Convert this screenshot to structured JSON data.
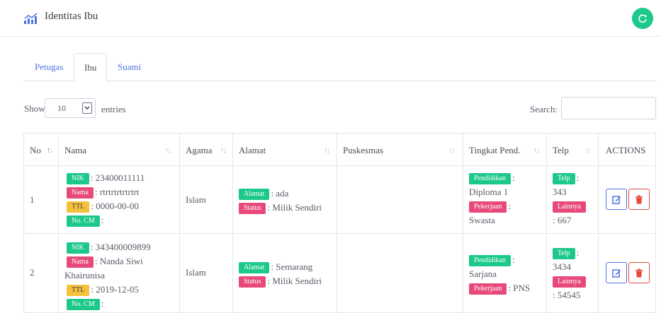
{
  "header": {
    "title": "Identitas Ibu",
    "accent": "#1cc88a"
  },
  "tabs": [
    {
      "label": "Petugas",
      "active": false
    },
    {
      "label": "Ibu",
      "active": true
    },
    {
      "label": "Suami",
      "active": false
    }
  ],
  "controls": {
    "show_label": "Show",
    "entries_value": "10",
    "entries_label": "entries",
    "search_label": "Search:",
    "search_value": ""
  },
  "columns": [
    "No",
    "Nama",
    "Agama",
    "Alamat",
    "Puskesmas",
    "Tingkat Pend.",
    "Telp",
    "ACTIONS"
  ],
  "rows": [
    {
      "no": "1",
      "nik_badge": "NIK",
      "nik": ": 23400011111",
      "nama_badge": "Nama",
      "nama": ": rtrtrtrtrtrtrt",
      "ttl_badge": "TTL",
      "ttl": ": 0000-00-00",
      "nocm_badge": "No. CM",
      "nocm": ":",
      "agama": "Islam",
      "alamat_badge": "Alamat",
      "alamat": ": ada",
      "status_badge": "Status",
      "status": ": Milik Sendiri",
      "puskesmas": "",
      "pendidikan_badge": "Pendidikan",
      "pendidikan_sep": ":",
      "pendidikan": "Diploma 1",
      "pekerjaan_badge": "Pekerjaan",
      "pekerjaan_sep": ":",
      "pekerjaan": "Swasta",
      "telp_badge": "Telp",
      "telp_sep": ":",
      "telp": "343",
      "lainnya_badge": "Lainnya",
      "lainnya": ": 667"
    },
    {
      "no": "2",
      "nik_badge": "NIK",
      "nik": ": 343400009899",
      "nama_badge": "Nama",
      "nama": ": Nanda Siwi",
      "nama2": "Khairunisa",
      "ttl_badge": "TTL",
      "ttl": ": 2019-12-05",
      "nocm_badge": "No. CM",
      "nocm": ":",
      "agama": "Islam",
      "alamat_badge": "Alamat",
      "alamat": ": Semarang",
      "status_badge": "Status",
      "status": ": Milik Sendiri",
      "puskesmas": "",
      "pendidikan_badge": "Pendidikan",
      "pendidikan_sep": ":",
      "pendidikan": "Sarjana",
      "pekerjaan_badge": "Pekerjaan",
      "pekerjaan": ": PNS",
      "telp_badge": "Telp",
      "telp_sep": ":",
      "telp": "3434",
      "lainnya_badge": "Lainnya",
      "lainnya": ": 54545"
    }
  ]
}
